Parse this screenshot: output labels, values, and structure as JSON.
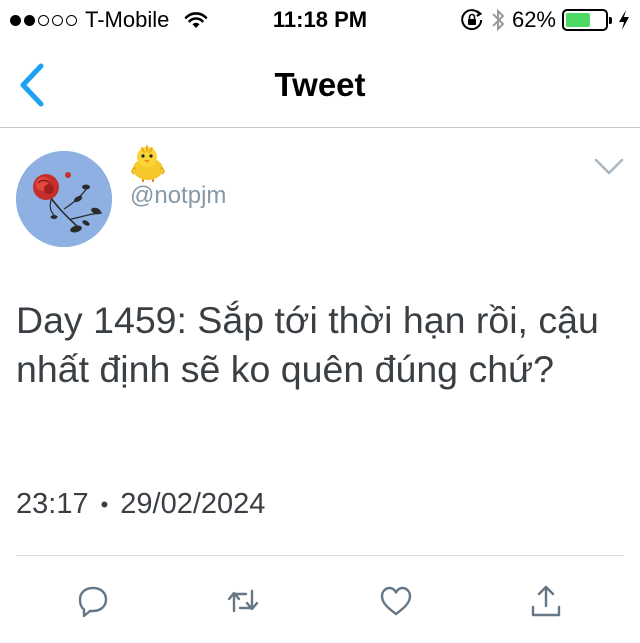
{
  "status_bar": {
    "carrier": "T-Mobile",
    "time": "11:18 PM",
    "battery_percent": "62%",
    "battery_level": 0.62,
    "signal_bars_filled": 2,
    "signal_bars_total": 5,
    "icons": [
      "wifi-icon",
      "orientation-lock-icon",
      "bluetooth-icon",
      "battery-icon",
      "charging-bolt-icon"
    ],
    "battery_color": "#4cd964"
  },
  "nav": {
    "title": "Tweet",
    "back_icon": "chevron-left-icon",
    "accent_color": "#1da1f2"
  },
  "tweet": {
    "display_name_emoji": "baby-chick-emoji",
    "handle": "@notpjm",
    "avatar": "red-rose-avatar",
    "text": "Day 1459: Sắp tới thời hạn rồi, cậu nhất định sẽ ko quên đúng chứ?",
    "time": "23:17",
    "separator": "•",
    "date": "29/02/2024"
  },
  "actions": [
    "reply-icon",
    "retweet-icon",
    "like-icon",
    "share-icon"
  ]
}
